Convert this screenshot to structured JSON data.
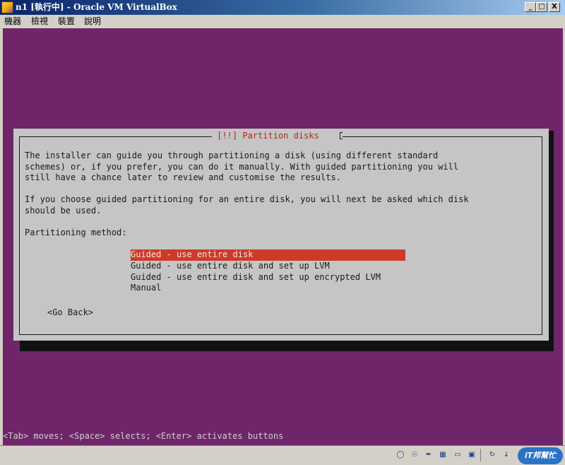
{
  "window": {
    "title": "n1 [執行中] - Oracle VM VirtualBox",
    "minimize_glyph": "_",
    "maximize_glyph": "□",
    "close_glyph": "X"
  },
  "menu": {
    "items": [
      "機器",
      "檢視",
      "裝置",
      "說明"
    ]
  },
  "installer": {
    "dialog_title": " [!!] Partition disks ",
    "paragraph1": [
      "The installer can guide you through partitioning a disk (using different standard",
      "schemes) or, if you prefer, you can do it manually. With guided partitioning you will",
      "still have a chance later to review and customise the results."
    ],
    "paragraph2": [
      "If you choose guided partitioning for an entire disk, you will next be asked which disk",
      "should be used."
    ],
    "method_label": "Partitioning method:",
    "methods": [
      "Guided - use entire disk",
      "Guided - use entire disk and set up LVM",
      "Guided - use entire disk and set up encrypted LVM",
      "Manual"
    ],
    "selected_method": 0,
    "go_back": "<Go Back>",
    "help_line": "<Tab> moves; <Space> selects; <Enter> activates buttons"
  },
  "statusbar": {
    "icons": [
      "hard-disk-icon",
      "optical-drive-icon",
      "usb-icon",
      "network-icon",
      "shared-folders-icon",
      "display-icon",
      "capture-icon",
      "keyboard-icon"
    ],
    "watermark": "iT邦幫忙"
  },
  "colors": {
    "vm_background": "#6e256a",
    "dialog_background": "#c5c5c5",
    "selection": "#cf3a28",
    "title_red": "#b5281d"
  }
}
